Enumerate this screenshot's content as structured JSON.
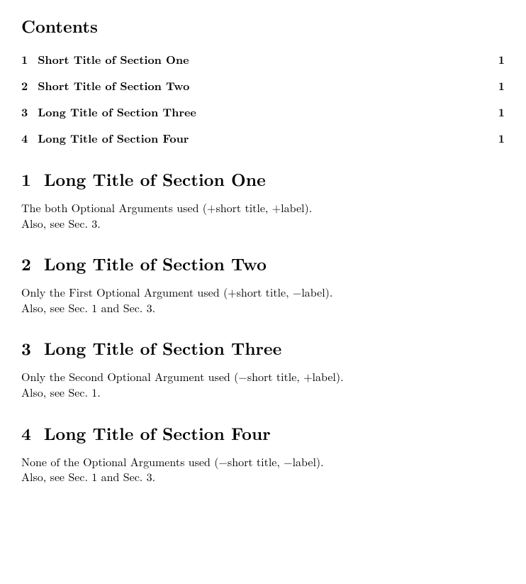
{
  "toc": {
    "title": "Contents",
    "entries": [
      {
        "num": "1",
        "title": "Short Title of Section One",
        "page": "1"
      },
      {
        "num": "2",
        "title": "Short Title of Section Two",
        "page": "1"
      },
      {
        "num": "3",
        "title": "Long Title of Section Three",
        "page": "1"
      },
      {
        "num": "4",
        "title": "Long Title of Section Four",
        "page": "1"
      }
    ]
  },
  "sections": [
    {
      "num": "1",
      "title": "Long Title of Section One",
      "line1": "The both Optional Arguments used (+short title, +label).",
      "line2": "Also, see Sec. 3."
    },
    {
      "num": "2",
      "title": "Long Title of Section Two",
      "line1": "Only the First Optional Argument used (+short title, −label).",
      "line2": "Also, see Sec. 1 and Sec. 3."
    },
    {
      "num": "3",
      "title": "Long Title of Section Three",
      "line1": "Only the Second Optional Argument used (−short title, +label).",
      "line2": "Also, see Sec. 1."
    },
    {
      "num": "4",
      "title": "Long Title of Section Four",
      "line1": "None of the Optional Arguments used (−short title, −label).",
      "line2": "Also, see Sec. 1 and Sec. 3."
    }
  ]
}
